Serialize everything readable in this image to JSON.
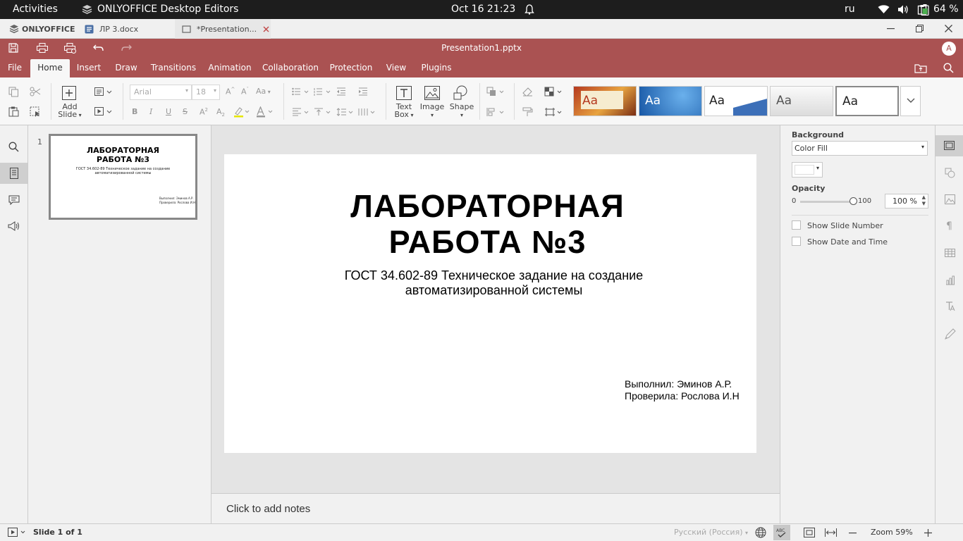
{
  "system_bar": {
    "activities": "Activities",
    "app_name": "ONLYOFFICE Desktop Editors",
    "clock": "Oct 16  21:23",
    "keyboard_layout": "ru",
    "battery": "64 %"
  },
  "tabs": {
    "brand": "ONLYOFFICE",
    "doc_tab": "ЛР 3.docx",
    "pres_tab": "*Presentation..."
  },
  "header": {
    "file_title": "Presentation1.pptx",
    "avatar_letter": "A",
    "menu": [
      "File",
      "Home",
      "Insert",
      "Draw",
      "Transitions",
      "Animation",
      "Collaboration",
      "Protection",
      "View",
      "Plugins"
    ],
    "active_menu": "Home",
    "brand_color": "#aa5252"
  },
  "toolbar": {
    "add_slide_line1": "Add",
    "add_slide_line2": "Slide",
    "font_name": "Arial",
    "font_size": "18",
    "textbox_line1": "Text",
    "textbox_line2": "Box",
    "image_label": "Image",
    "shape_label": "Shape",
    "theme_sample": "Aa"
  },
  "slide": {
    "number": "1",
    "title_line1": "ЛАБОРАТОРНАЯ",
    "title_line2": "РАБОТА №3",
    "subtitle_line1": "ГОСТ 34.602-89 Техническое задание на создание",
    "subtitle_line2": "автоматизированной системы",
    "author_line1": "Выполнил: Эминов А.Р.",
    "author_line2": "Проверила: Рослова И.Н"
  },
  "notes": {
    "placeholder": "Click to add notes"
  },
  "right_panel": {
    "background_label": "Background",
    "fill_type": "Color Fill",
    "opacity_label": "Opacity",
    "opacity_min": "0",
    "opacity_max": "100",
    "opacity_value": "100 %",
    "opacity_fraction": 1.0,
    "show_slide_number": "Show Slide Number",
    "show_date_time": "Show Date and Time"
  },
  "status": {
    "slide_counter": "Slide 1 of 1",
    "language": "Русский (Россия)",
    "zoom": "Zoom 59%"
  }
}
